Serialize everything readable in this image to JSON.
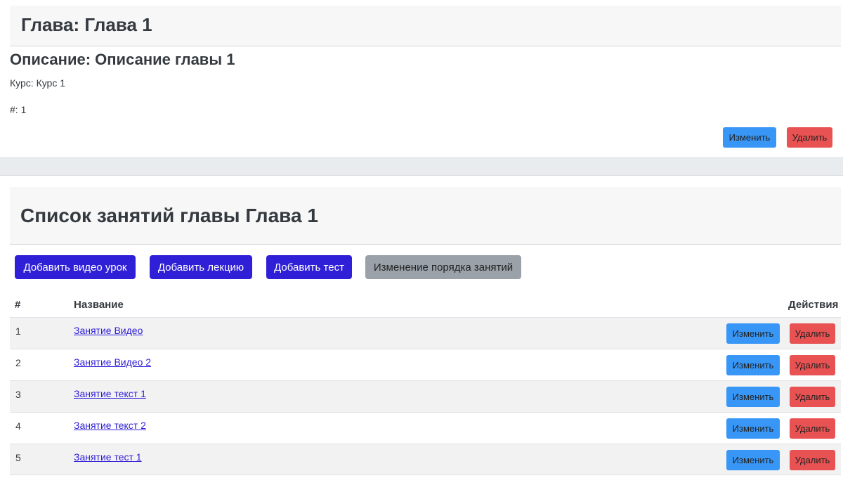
{
  "chapter": {
    "title": "Глава: Глава 1",
    "description": "Описание: Описание главы 1",
    "course": "Курс: Курс 1",
    "number": "#: 1",
    "edit_label": "Изменить",
    "delete_label": "Удалить"
  },
  "lessons_section": {
    "title": "Список занятий главы Глава 1",
    "buttons": {
      "add_video": "Добавить видео урок",
      "add_lecture": "Добавить лекцию",
      "add_test": "Добавить тест",
      "reorder": "Изменение порядка занятий"
    },
    "columns": {
      "num": "#",
      "name": "Название",
      "actions": "Действия"
    },
    "rows": [
      {
        "num": "1",
        "name": "Занятие Видео",
        "edit": "Изменить",
        "delete": "Удалить"
      },
      {
        "num": "2",
        "name": "Занятие Видео 2",
        "edit": "Изменить",
        "delete": "Удалить"
      },
      {
        "num": "3",
        "name": "Занятие текст 1",
        "edit": "Изменить",
        "delete": "Удалить"
      },
      {
        "num": "4",
        "name": "Занятие текст 2",
        "edit": "Изменить",
        "delete": "Удалить"
      },
      {
        "num": "5",
        "name": "Занятие тест 1",
        "edit": "Изменить",
        "delete": "Удалить"
      }
    ]
  },
  "colors": {
    "primary_blue": "#3796f6",
    "danger_red": "#e85252",
    "accent_purple": "#2f1fd7",
    "secondary_gray": "#9aa1a9"
  }
}
